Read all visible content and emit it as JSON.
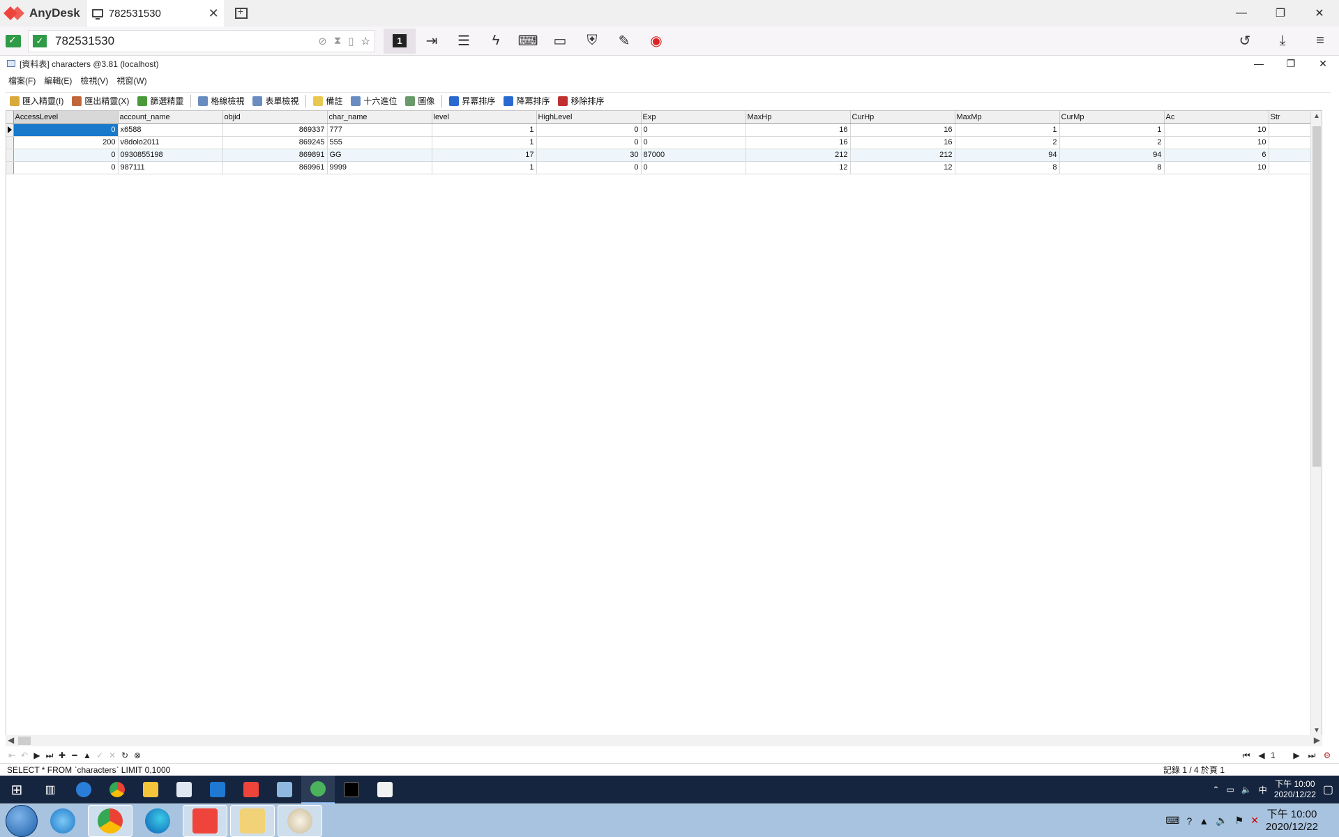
{
  "anydesk": {
    "app_name": "AnyDesk",
    "tab_label": "782531530",
    "address": "782531530",
    "monitor_number": "1"
  },
  "navicat": {
    "window_title": "[資料表] characters @3.81 (localhost)",
    "menu": [
      "檔案(F)",
      "編輯(E)",
      "檢視(V)",
      "視窗(W)"
    ],
    "toolbar": [
      {
        "label": "匯入精靈(I)",
        "color": "#d9a93a"
      },
      {
        "label": "匯出精靈(X)",
        "color": "#c0663a"
      },
      {
        "label": "篩選精靈",
        "color": "#4a9a3a"
      },
      {
        "label": "格線檢視",
        "color": "#6a8cc0"
      },
      {
        "label": "表單檢視",
        "color": "#6a8cc0"
      },
      {
        "label": "備註",
        "color": "#e8c850"
      },
      {
        "label": "十六進位",
        "color": "#6a8cc0"
      },
      {
        "label": "圖像",
        "color": "#6a9a6a"
      },
      {
        "label": "昇冪排序",
        "color": "#2a6ad0"
      },
      {
        "label": "降冪排序",
        "color": "#2a6ad0"
      },
      {
        "label": "移除排序",
        "color": "#c03030"
      }
    ],
    "columns": [
      "AccessLevel",
      "account_name",
      "objid",
      "char_name",
      "level",
      "HighLevel",
      "Exp",
      "MaxHp",
      "CurHp",
      "MaxMp",
      "CurMp",
      "Ac",
      "Str"
    ],
    "rows": [
      [
        "0",
        "x6588",
        "869337",
        "777",
        "1",
        "0",
        "0",
        "16",
        "16",
        "1",
        "1",
        "10",
        ""
      ],
      [
        "200",
        "v8dolo2011",
        "869245",
        "555",
        "1",
        "0",
        "0",
        "16",
        "16",
        "2",
        "2",
        "10",
        ""
      ],
      [
        "0",
        "0930855198",
        "869891",
        "GG",
        "17",
        "30",
        "87000",
        "212",
        "212",
        "94",
        "94",
        "6",
        ""
      ],
      [
        "0",
        "987111",
        "869961",
        "9999",
        "1",
        "0",
        "0",
        "12",
        "12",
        "8",
        "8",
        "10",
        ""
      ]
    ],
    "page_number": "1",
    "status_sql": "SELECT * FROM `characters` LIMIT 0,1000",
    "status_records": "記錄 1 / 4 於頁 1"
  },
  "remote_taskbar": {
    "time": "下午 10:00",
    "date": "2020/12/22",
    "ime": "中"
  },
  "local_taskbar": {
    "time": "下午 10:00",
    "date": "2020/12/22"
  }
}
